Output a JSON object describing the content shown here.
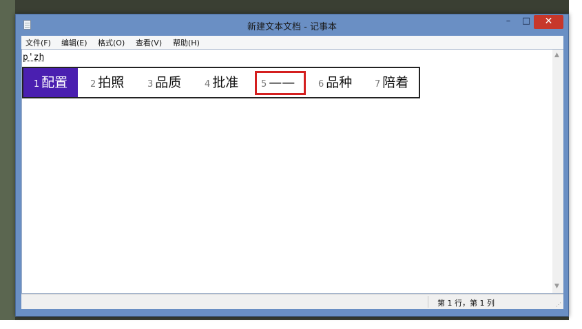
{
  "window": {
    "title": "新建文本文档 - 记事本"
  },
  "controls": {
    "minimize": "–",
    "maximize": "□",
    "close": "✕"
  },
  "menu": {
    "file": "文件(F)",
    "edit": "编辑(E)",
    "format": "格式(O)",
    "view": "查看(V)",
    "help": "帮助(H)"
  },
  "editor": {
    "text": "p'zh"
  },
  "ime": {
    "candidates": [
      {
        "num": "1",
        "text": "配置"
      },
      {
        "num": "2",
        "text": "拍照"
      },
      {
        "num": "3",
        "text": "品质"
      },
      {
        "num": "4",
        "text": "批准"
      },
      {
        "num": "5",
        "text": "——"
      },
      {
        "num": "6",
        "text": "品种"
      },
      {
        "num": "7",
        "text": "陪着"
      }
    ],
    "selected_index": 0,
    "highlight_color": "#4a1fb0",
    "outline_color": "#d41f1f"
  },
  "status": {
    "position": "第 1 行，第 1 列"
  },
  "scrollbar": {
    "up": "▲",
    "down": "▼"
  },
  "icons": {
    "app": "notepad-icon",
    "grip": "resize-grip-icon"
  }
}
